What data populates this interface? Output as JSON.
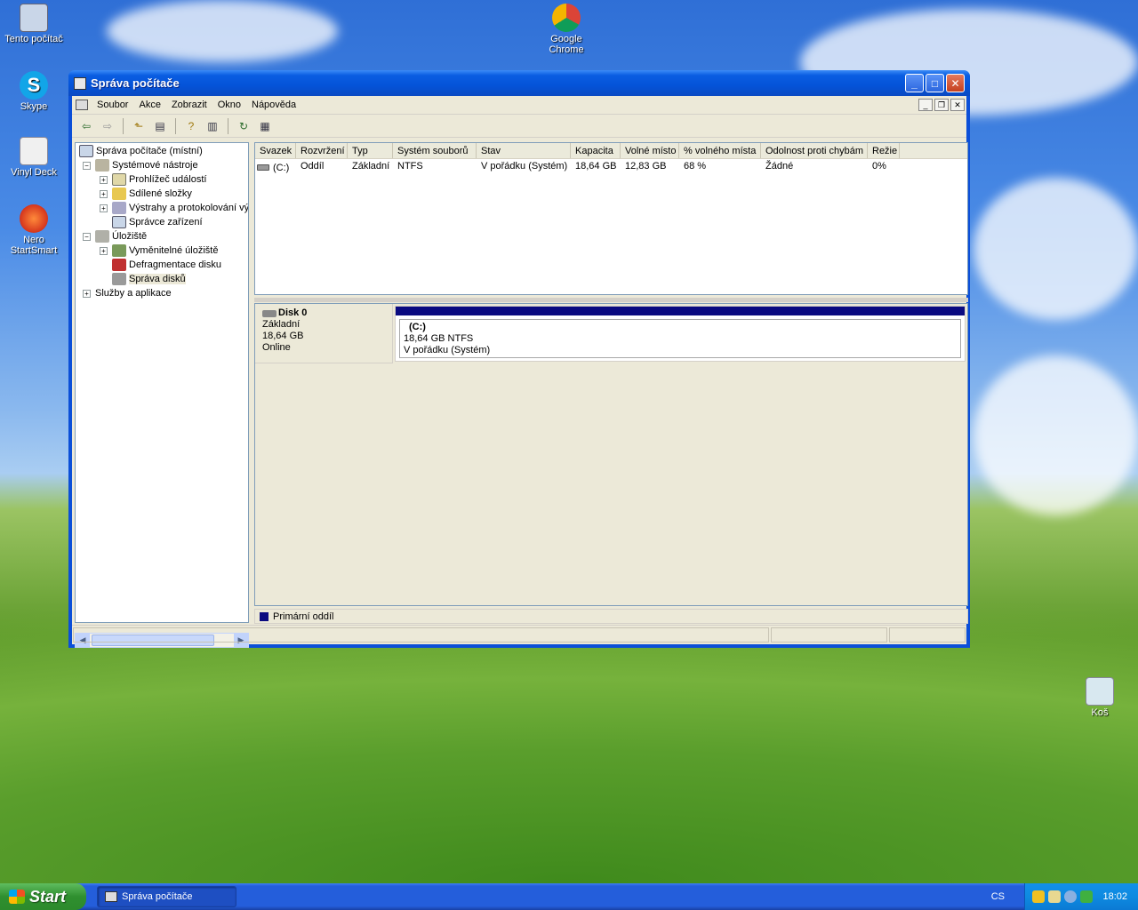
{
  "desktop": {
    "icons": [
      {
        "label": "Tento počítač",
        "icon": "my-computer-icon"
      },
      {
        "label": "Skype",
        "icon": "skype-icon"
      },
      {
        "label": "Vinyl Deck",
        "icon": "vinyl-deck-icon"
      },
      {
        "label": "Nero StartSmart",
        "icon": "nero-icon"
      },
      {
        "label": "Google Chrome",
        "icon": "chrome-icon"
      },
      {
        "label": "Koš",
        "icon": "recycle-bin-icon"
      }
    ]
  },
  "window": {
    "title": "Správa počítače",
    "menu": [
      "Soubor",
      "Akce",
      "Zobrazit",
      "Okno",
      "Nápověda"
    ],
    "toolbar": [
      "back-icon",
      "forward-icon",
      "up-folder-icon",
      "show-hide-tree-icon",
      "help-icon",
      "properties-icon",
      "refresh-icon",
      "export-icon"
    ]
  },
  "tree": {
    "nodes": [
      {
        "label": "Správa počítače (místní)",
        "level": 0,
        "expander": "",
        "icon": "computer-icon"
      },
      {
        "label": "Systémové nástroje",
        "level": 1,
        "expander": "−",
        "icon": "tools-icon"
      },
      {
        "label": "Prohlížeč událostí",
        "level": 2,
        "expander": "+",
        "icon": "event-viewer-icon"
      },
      {
        "label": "Sdílené složky",
        "level": 2,
        "expander": "+",
        "icon": "shared-folders-icon"
      },
      {
        "label": "Výstrahy a protokolování vý",
        "level": 2,
        "expander": "+",
        "icon": "alerts-icon"
      },
      {
        "label": "Správce zařízení",
        "level": 2,
        "expander": "",
        "icon": "device-manager-icon"
      },
      {
        "label": "Úložiště",
        "level": 1,
        "expander": "−",
        "icon": "storage-icon"
      },
      {
        "label": "Vyměnitelné úložiště",
        "level": 2,
        "expander": "+",
        "icon": "removable-storage-icon"
      },
      {
        "label": "Defragmentace disku",
        "level": 2,
        "expander": "",
        "icon": "defrag-icon"
      },
      {
        "label": "Správa disků",
        "level": 2,
        "expander": "",
        "icon": "disk-management-icon",
        "selected": true
      },
      {
        "label": "Služby a aplikace",
        "level": 1,
        "expander": "+",
        "icon": "services-icon"
      }
    ]
  },
  "volumes": {
    "columns": [
      "Svazek",
      "Rozvržení",
      "Typ",
      "Systém souborů",
      "Stav",
      "Kapacita",
      "Volné místo",
      "% volného místa",
      "Odolnost proti chybám",
      "Režie"
    ],
    "rows": [
      [
        "(C:)",
        "Oddíl",
        "Základní",
        "NTFS",
        "V pořádku (Systém)",
        "18,64 GB",
        "12,83 GB",
        "68 %",
        "Žádné",
        "0%"
      ]
    ]
  },
  "disk": {
    "name": "Disk 0",
    "type": "Základní",
    "size": "18,64 GB",
    "status": "Online",
    "partition": {
      "name": "(C:)",
      "size_fs": "18,64 GB NTFS",
      "status": "V pořádku (Systém)",
      "color": "#0a0a80"
    }
  },
  "legend": {
    "label": "Primární oddíl",
    "color": "#0a0a80"
  },
  "taskbar": {
    "start": "Start",
    "task": "Správa počítače",
    "language": "CS",
    "clock": "18:02"
  }
}
